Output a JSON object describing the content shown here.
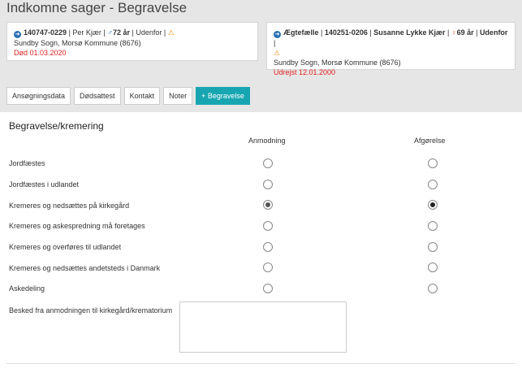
{
  "page": {
    "title": "Indkomne sager - Begravelse"
  },
  "deceased": {
    "id": "140747-0229",
    "name": "Per Kjær",
    "age": "72 år",
    "status": "Udenfor",
    "address": "Sundby Sogn, Morsø Kommune (8676)",
    "event": "Død 01.03.2020"
  },
  "spouse": {
    "relation": "Ægtefælle",
    "id": "140251-0206",
    "name": "Susanne Lykke Kjær",
    "age": "69 år",
    "status": "Udenfor",
    "address": "Sundby Sogn, Morsø Kommune (8676)",
    "event": "Udrejst 12.01.2000"
  },
  "tabs": [
    {
      "label": "Ansøgningsdata",
      "active": false
    },
    {
      "label": "Dødsattest",
      "active": false
    },
    {
      "label": "Kontakt",
      "active": false
    },
    {
      "label": "Noter",
      "active": false
    },
    {
      "label": "+ Begravelse",
      "active": true
    }
  ],
  "section": {
    "title": "Begravelse/kremering",
    "col_request": "Anmodning",
    "col_decision": "Afgørelse",
    "options": [
      {
        "label": "Jordfæstes",
        "request": false,
        "decision": false
      },
      {
        "label": "Jordfæstes i udlandet",
        "request": false,
        "decision": false
      },
      {
        "label": "Kremeres og nedsættes på kirkegård",
        "request": true,
        "decision": true
      },
      {
        "label": "Kremeres og askespredning må foretages",
        "request": false,
        "decision": false
      },
      {
        "label": "Kremeres og overføres til udlandet",
        "request": false,
        "decision": false
      },
      {
        "label": "Kremeres og nedsættes andetsteds i Danmark",
        "request": false,
        "decision": false
      },
      {
        "label": "Askedeling",
        "request": false,
        "decision": false
      }
    ],
    "message_label": "Besked fra anmodningen til kirkegård/krematorium",
    "message_value": ""
  },
  "colors": {
    "accent": "#17a6b1",
    "death_red": "#e02020",
    "warning": "#e8891c"
  }
}
